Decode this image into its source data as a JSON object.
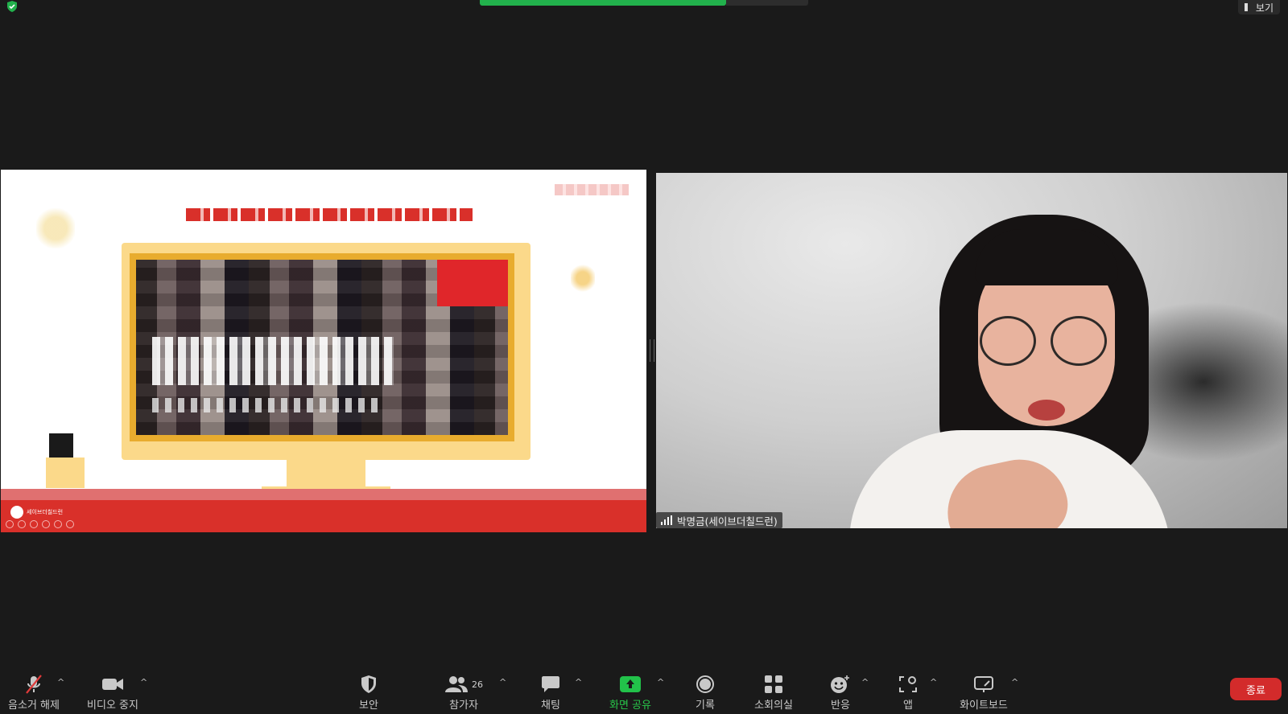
{
  "top": {
    "view_label": "보기"
  },
  "slide": {
    "logo_text": "세이브더칠드런"
  },
  "video": {
    "participant_name": "박명금(세이브더칠드런)"
  },
  "toolbar": {
    "mute_label": "음소거 해제",
    "video_label": "비디오 중지",
    "security_label": "보안",
    "participants_label": "참가자",
    "participants_count": "26",
    "chat_label": "채팅",
    "share_label": "화면 공유",
    "record_label": "기록",
    "breakout_label": "소회의실",
    "reactions_label": "반응",
    "apps_label": "앱",
    "whiteboard_label": "화이트보드",
    "end_label": "종료"
  },
  "colors": {
    "accent_green": "#22b14c",
    "end_red": "#d32b2b",
    "slide_red": "#d9302a"
  }
}
